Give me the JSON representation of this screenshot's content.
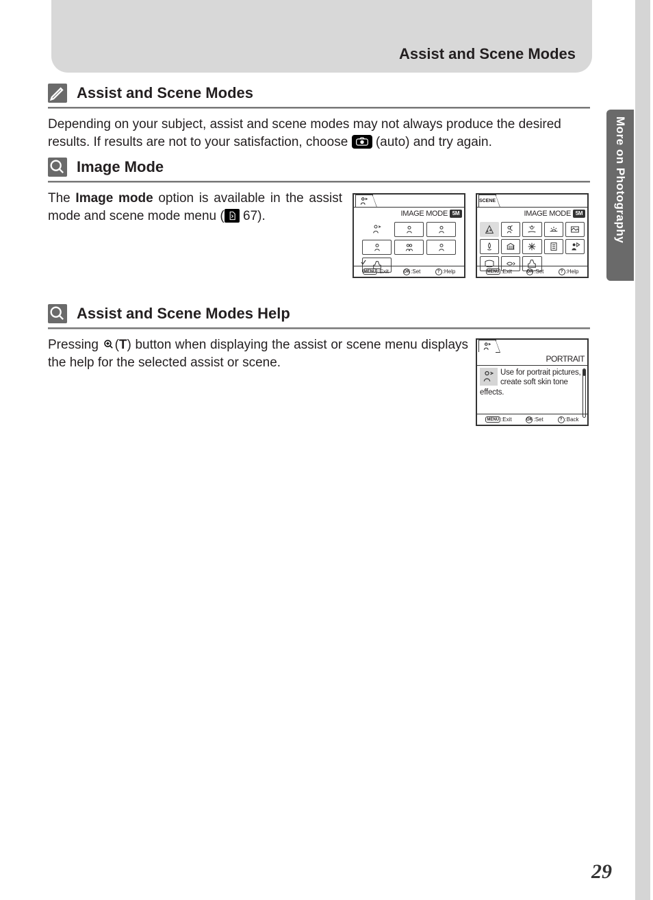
{
  "header": {
    "title": "Assist and Scene Modes"
  },
  "side_tab": "More on Photography",
  "page_number": "29",
  "sections": {
    "assist_scene": {
      "title": "Assist and Scene Modes",
      "body_pre": "Depending on your subject, assist and scene modes may not always produce the desired results. If results are not to your satisfaction, choose ",
      "body_post": " (auto) and try again."
    },
    "image_mode": {
      "title": "Image Mode",
      "body_pre1": "The ",
      "body_bold": "Image mode",
      "body_mid": " option is available in the assist mode and scene mode menu (",
      "body_pageref": " 67).",
      "lcd_assist": {
        "title": "IMAGE MODE",
        "badge": "5M",
        "footer": {
          "exit": ":Exit",
          "set": ":Set",
          "help": ":Help",
          "menu_label": "MENU",
          "ok_label": "OK",
          "q_label": "?"
        },
        "cells": [
          {
            "icon": "portrait-assist"
          },
          {
            "icon": "person-rect"
          },
          {
            "icon": "person-rect"
          },
          {
            "icon": "person-rect"
          },
          {
            "icon": "two-person"
          },
          {
            "icon": "person-rect"
          },
          {
            "icon": "image-quality",
            "checked": true
          }
        ]
      },
      "lcd_scene": {
        "tab": "SCENE",
        "title": "IMAGE MODE",
        "badge": "5M",
        "footer": {
          "exit": ":Exit",
          "set": ":Set",
          "help": ":Help",
          "menu_label": "MENU",
          "ok_label": "OK",
          "q_label": "?"
        },
        "cells": [
          {
            "icon": "party",
            "selected": true
          },
          {
            "icon": "night-portrait"
          },
          {
            "icon": "beach"
          },
          {
            "icon": "sunset"
          },
          {
            "icon": "landscape-frame"
          },
          {
            "icon": "closeup"
          },
          {
            "icon": "museum"
          },
          {
            "icon": "fireworks"
          },
          {
            "icon": "copy"
          },
          {
            "icon": "backlight"
          },
          {
            "icon": "panorama"
          },
          {
            "icon": "underwater"
          },
          {
            "icon": "image-quality"
          }
        ]
      }
    },
    "help": {
      "title": "Assist and Scene Modes Help",
      "body_pre": "Pressing ",
      "body_t": "T",
      "body_post": ") button when displaying the assist or scene menu  displays the help for the selected assist or scene.",
      "lcd": {
        "title": "PORTRAIT",
        "body": "Use for portrait pictures, create soft skin tone effects.",
        "footer": {
          "exit": ":Exit",
          "set": ":Set",
          "back": ":Back",
          "menu_label": "MENU",
          "ok_label": "OK",
          "q_label": "?"
        }
      }
    }
  }
}
